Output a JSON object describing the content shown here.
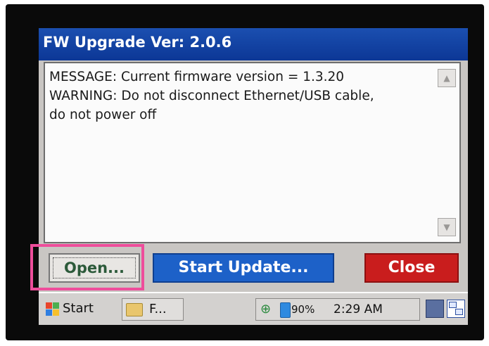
{
  "window": {
    "title": "FW Upgrade Ver: 2.0.6"
  },
  "message_box": {
    "lines": "MESSAGE: Current firmware version = 1.3.20\nWARNING: Do not disconnect Ethernet/USB cable,\ndo not power off"
  },
  "buttons": {
    "open": "Open...",
    "start_update": "Start Update...",
    "close": "Close"
  },
  "taskbar": {
    "start_label": "Start",
    "task_item_label": "F...",
    "battery_percent": "90%",
    "clock": "2:29 AM"
  },
  "colors": {
    "title_bar": "#0c3796",
    "start_update_button": "#1d61c8",
    "close_button": "#c91d1d",
    "highlight_box": "#ee4d9b"
  },
  "icons": {
    "scroll_up": "scroll-up-arrow-icon",
    "scroll_down": "scroll-down-arrow-icon",
    "start": "windows-flag-icon",
    "task_item": "folder-icon",
    "network": "network-icon",
    "battery": "battery-icon",
    "keyboard": "keyboard-icon",
    "desktop": "desktop-switch-icon"
  }
}
